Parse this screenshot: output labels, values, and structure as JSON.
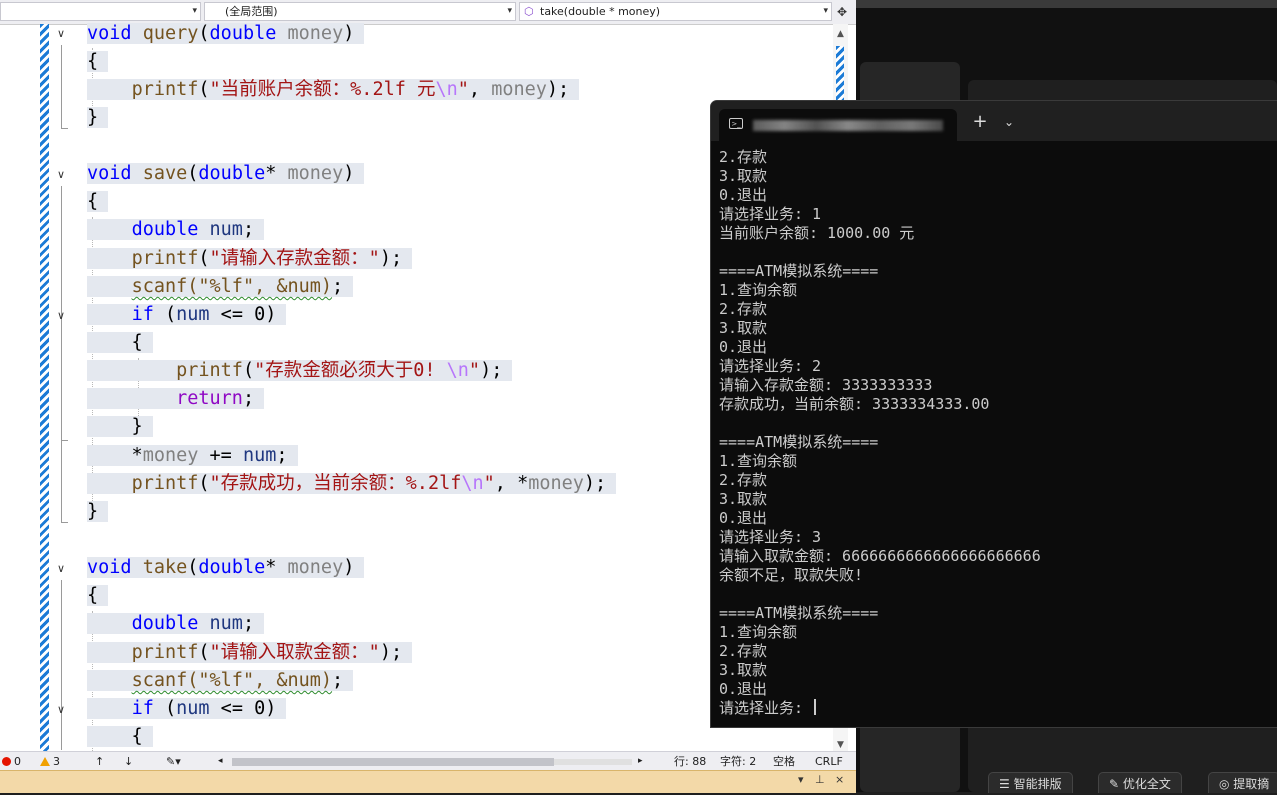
{
  "navbar": {
    "dropdown1": "",
    "dropdown2": "(全局范围)",
    "dropdown3": "take(double * money)"
  },
  "status": {
    "errors": "0",
    "warnings": "3",
    "line": "行: 88",
    "char": "字符: 2",
    "space": "空格",
    "eol": "CRLF"
  },
  "editor": {
    "lines": [
      [
        [
          "kw",
          "void"
        ],
        [
          "t",
          " "
        ],
        [
          "fn",
          "query"
        ],
        [
          "t",
          "("
        ],
        [
          "kw",
          "double"
        ],
        [
          "t",
          " "
        ],
        [
          "pm",
          "money"
        ],
        [
          "t",
          ")"
        ]
      ],
      [
        [
          "t",
          "{"
        ]
      ],
      [
        [
          "t",
          "    "
        ],
        [
          "fn",
          "printf"
        ],
        [
          "t",
          "("
        ],
        [
          "st",
          "\"当前账户余额：%.2lf 元"
        ],
        [
          "es",
          "\\n"
        ],
        [
          "st",
          "\""
        ],
        [
          "t",
          ", "
        ],
        [
          "pm",
          "money"
        ],
        [
          "t",
          ");"
        ]
      ],
      [
        [
          "t",
          "}"
        ]
      ],
      [],
      [
        [
          "kw",
          "void"
        ],
        [
          "t",
          " "
        ],
        [
          "fn",
          "save"
        ],
        [
          "t",
          "("
        ],
        [
          "kw",
          "double"
        ],
        [
          "t",
          "* "
        ],
        [
          "pm",
          "money"
        ],
        [
          "t",
          ")"
        ]
      ],
      [
        [
          "t",
          "{"
        ]
      ],
      [
        [
          "t",
          "    "
        ],
        [
          "kw",
          "double"
        ],
        [
          "t",
          " "
        ],
        [
          "vr",
          "num"
        ],
        [
          "t",
          ";"
        ]
      ],
      [
        [
          "t",
          "    "
        ],
        [
          "fn",
          "printf"
        ],
        [
          "t",
          "("
        ],
        [
          "st",
          "\"请输入存款金额：\""
        ],
        [
          "t",
          ");"
        ]
      ],
      [
        [
          "t",
          "    "
        ],
        [
          "fnsq",
          "scanf(\"%lf\", &num)"
        ],
        [
          "t",
          ";"
        ]
      ],
      [
        [
          "t",
          "    "
        ],
        [
          "kw",
          "if"
        ],
        [
          "t",
          " ("
        ],
        [
          "vr",
          "num"
        ],
        [
          "t",
          " <= 0)"
        ]
      ],
      [
        [
          "t",
          "    {"
        ]
      ],
      [
        [
          "t",
          "        "
        ],
        [
          "fn",
          "printf"
        ],
        [
          "t",
          "("
        ],
        [
          "st",
          "\"存款金额必须大于0! "
        ],
        [
          "es",
          "\\n"
        ],
        [
          "st",
          "\""
        ],
        [
          "t",
          ");"
        ]
      ],
      [
        [
          "t",
          "        "
        ],
        [
          "rt",
          "return"
        ],
        [
          "t",
          ";"
        ]
      ],
      [
        [
          "t",
          "    }"
        ]
      ],
      [
        [
          "t",
          "    *"
        ],
        [
          "pm",
          "money"
        ],
        [
          "t",
          " += "
        ],
        [
          "vr",
          "num"
        ],
        [
          "t",
          ";"
        ]
      ],
      [
        [
          "t",
          "    "
        ],
        [
          "fn",
          "printf"
        ],
        [
          "t",
          "("
        ],
        [
          "st",
          "\"存款成功，当前余额：%.2lf"
        ],
        [
          "es",
          "\\n"
        ],
        [
          "st",
          "\""
        ],
        [
          "t",
          ", *"
        ],
        [
          "pm",
          "money"
        ],
        [
          "t",
          ");"
        ]
      ],
      [
        [
          "t",
          "}"
        ]
      ],
      [],
      [
        [
          "kw",
          "void"
        ],
        [
          "t",
          " "
        ],
        [
          "fn",
          "take"
        ],
        [
          "t",
          "("
        ],
        [
          "kw",
          "double"
        ],
        [
          "t",
          "* "
        ],
        [
          "pm",
          "money"
        ],
        [
          "t",
          ")"
        ]
      ],
      [
        [
          "t",
          "{"
        ]
      ],
      [
        [
          "t",
          "    "
        ],
        [
          "kw",
          "double"
        ],
        [
          "t",
          " "
        ],
        [
          "vr",
          "num"
        ],
        [
          "t",
          ";"
        ]
      ],
      [
        [
          "t",
          "    "
        ],
        [
          "fn",
          "printf"
        ],
        [
          "t",
          "("
        ],
        [
          "st",
          "\"请输入取款金额：\""
        ],
        [
          "t",
          ");"
        ]
      ],
      [
        [
          "t",
          "    "
        ],
        [
          "fnsq",
          "scanf(\"%lf\", &num)"
        ],
        [
          "t",
          ";"
        ]
      ],
      [
        [
          "t",
          "    "
        ],
        [
          "kw",
          "if"
        ],
        [
          "t",
          " ("
        ],
        [
          "vr",
          "num"
        ],
        [
          "t",
          " <= 0)"
        ]
      ],
      [
        [
          "t",
          "    {"
        ]
      ]
    ]
  },
  "terminal": {
    "tab_title": "",
    "new_tab": "+",
    "dropdown": "⌄",
    "lines": [
      "2.存款",
      "3.取款",
      "0.退出",
      "请选择业务: 1",
      "当前账户余额: 1000.00 元",
      "",
      "====ATM模拟系统====",
      "1.查询余额",
      "2.存款",
      "3.取款",
      "0.退出",
      "请选择业务: 2",
      "请输入存款金额: 3333333333",
      "存款成功，当前余额: 3333334333.00",
      "",
      "====ATM模拟系统====",
      "1.查询余额",
      "2.存款",
      "3.取款",
      "0.退出",
      "请选择业务: 3",
      "请输入取款金额: 6666666666666666666666",
      "余额不足，取款失败!",
      "",
      "====ATM模拟系统====",
      "1.查询余额",
      "2.存款",
      "3.取款",
      "0.退出",
      "请选择业务: "
    ]
  },
  "background_app": {
    "buttons": [
      "智能排版",
      "优化全文",
      "提取摘"
    ]
  }
}
